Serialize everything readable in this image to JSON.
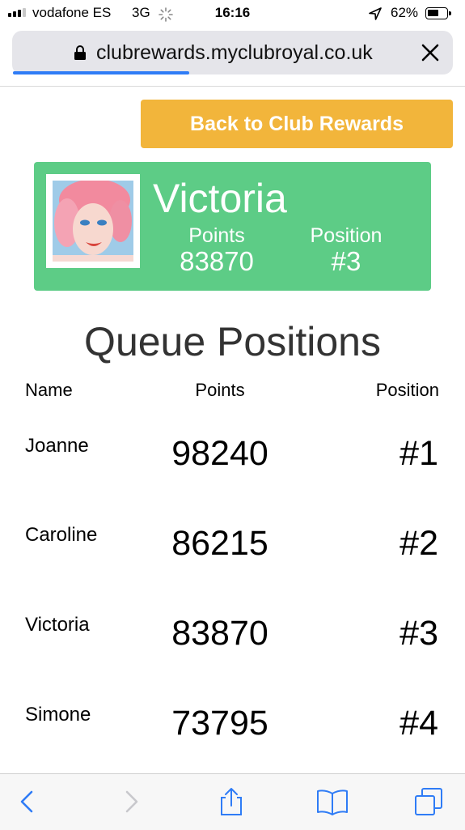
{
  "status_bar": {
    "carrier": "vodafone ES",
    "network": "3G",
    "time": "16:16",
    "battery_percent": "62%",
    "battery_level": 0.62
  },
  "browser": {
    "url": "clubrewards.myclubroyal.co.uk",
    "load_progress": 0.4
  },
  "back_button": {
    "label": "Back to Club Rewards"
  },
  "profile": {
    "name": "Victoria",
    "points_label": "Points",
    "points_value": "83870",
    "position_label": "Position",
    "position_value": "#3"
  },
  "queue": {
    "title": "Queue Positions",
    "headers": {
      "name": "Name",
      "points": "Points",
      "position": "Position"
    },
    "rows": [
      {
        "name": "Joanne",
        "points": "98240",
        "position": "#1"
      },
      {
        "name": "Caroline",
        "points": "86215",
        "position": "#2"
      },
      {
        "name": "Victoria",
        "points": "83870",
        "position": "#3"
      },
      {
        "name": "Simone",
        "points": "73795",
        "position": "#4"
      }
    ]
  },
  "toolbar": {
    "icons": [
      "back-arrow-icon",
      "forward-arrow-icon",
      "share-icon",
      "bookmarks-icon",
      "tabs-icon"
    ]
  },
  "colors": {
    "accent_button": "#f2b53b",
    "profile_card": "#5dcc86",
    "ios_blue": "#2f7cf6"
  }
}
